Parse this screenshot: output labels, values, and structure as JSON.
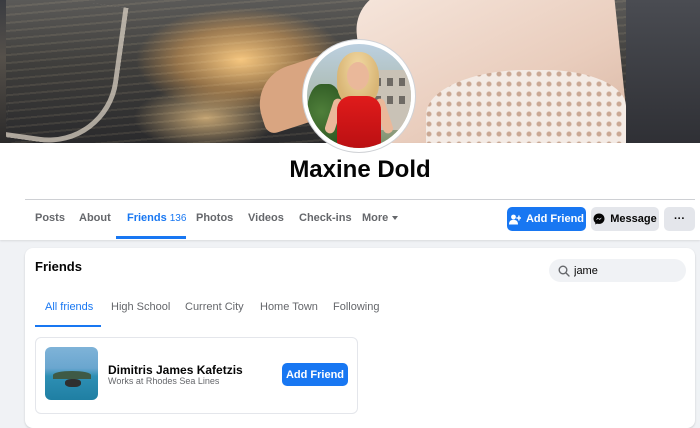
{
  "profile": {
    "name": "Maxine Dold"
  },
  "nav": {
    "tabs": [
      {
        "label": "Posts"
      },
      {
        "label": "About"
      },
      {
        "label": "Friends",
        "count": "136"
      },
      {
        "label": "Photos"
      },
      {
        "label": "Videos"
      },
      {
        "label": "Check-ins"
      },
      {
        "label": "More"
      }
    ],
    "active_tab": "Friends"
  },
  "actions": {
    "add_friend": "Add Friend",
    "message": "Message",
    "more": "···"
  },
  "friends_section": {
    "title": "Friends",
    "search_value": "jame",
    "filters": [
      {
        "label": "All friends"
      },
      {
        "label": "High School"
      },
      {
        "label": "Current City"
      },
      {
        "label": "Home Town"
      },
      {
        "label": "Following"
      }
    ],
    "active_filter": "All friends",
    "results": [
      {
        "name": "Dimitris James Kafetzis",
        "subtitle": "Works at Rhodes Sea Lines",
        "button": "Add Friend"
      }
    ]
  },
  "colors": {
    "accent": "#1877f2",
    "background": "#f0f2f5",
    "secondary_button": "#e4e6eb",
    "muted_text": "#65676b"
  }
}
